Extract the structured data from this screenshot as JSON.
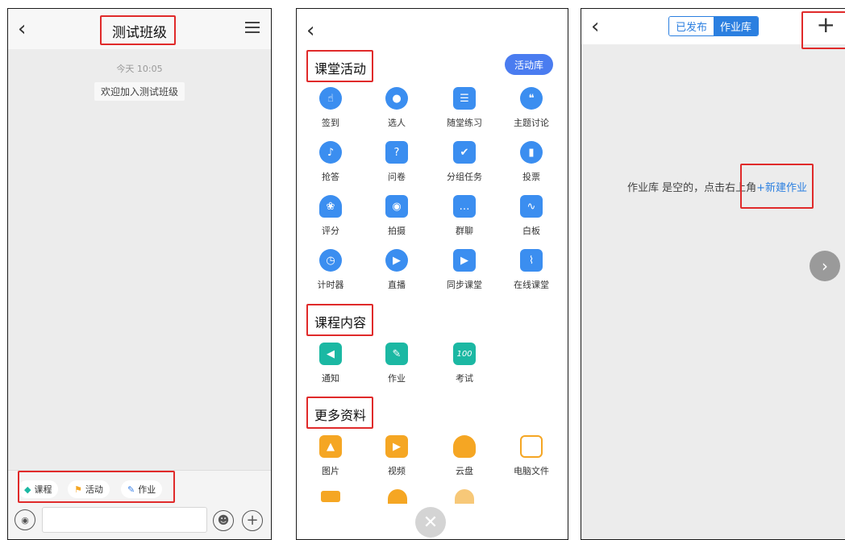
{
  "panel1": {
    "title": "测试班级",
    "timestamp": "今天 10:05",
    "welcome": "欢迎加入测试班级",
    "chips": [
      {
        "label": "课程",
        "icon": "course-icon"
      },
      {
        "label": "活动",
        "icon": "activity-icon"
      },
      {
        "label": "作业",
        "icon": "homework-icon"
      }
    ],
    "input": {
      "value": "",
      "placeholder": ""
    }
  },
  "panel2": {
    "sections": {
      "activities": "课堂活动",
      "content": "课程内容",
      "more": "更多资料"
    },
    "library_button": "活动库",
    "activities": [
      {
        "label": "签到",
        "icon": "sign-in-icon"
      },
      {
        "label": "选人",
        "icon": "pick-person-icon"
      },
      {
        "label": "随堂练习",
        "icon": "practice-icon"
      },
      {
        "label": "主题讨论",
        "icon": "discussion-icon"
      },
      {
        "label": "抢答",
        "icon": "quick-answer-icon"
      },
      {
        "label": "问卷",
        "icon": "questionnaire-icon"
      },
      {
        "label": "分组任务",
        "icon": "group-task-icon"
      },
      {
        "label": "投票",
        "icon": "vote-icon"
      },
      {
        "label": "评分",
        "icon": "rating-icon"
      },
      {
        "label": "拍摄",
        "icon": "camera-icon"
      },
      {
        "label": "群聊",
        "icon": "group-chat-icon"
      },
      {
        "label": "白板",
        "icon": "whiteboard-icon"
      },
      {
        "label": "计时器",
        "icon": "timer-icon"
      },
      {
        "label": "直播",
        "icon": "live-icon"
      },
      {
        "label": "同步课堂",
        "icon": "sync-class-icon"
      },
      {
        "label": "在线课堂",
        "icon": "online-class-icon"
      }
    ],
    "content": [
      {
        "label": "通知",
        "icon": "notice-icon"
      },
      {
        "label": "作业",
        "icon": "homework-icon"
      },
      {
        "label": "考试",
        "icon": "exam-icon"
      }
    ],
    "more": [
      {
        "label": "图片",
        "icon": "image-icon"
      },
      {
        "label": "视频",
        "icon": "video-icon"
      },
      {
        "label": "云盘",
        "icon": "cloud-drive-icon"
      },
      {
        "label": "电脑文件",
        "icon": "computer-file-icon"
      }
    ]
  },
  "panel3": {
    "tabs": {
      "published": "已发布",
      "library": "作业库"
    },
    "empty_text": "作业库 是空的，点击右上角",
    "empty_link": "+新建作业"
  },
  "colors": {
    "highlight": "#e02a2a",
    "accent": "#2b7fe0",
    "library_button": "#4a7cf0",
    "orange": "#f5a623"
  }
}
